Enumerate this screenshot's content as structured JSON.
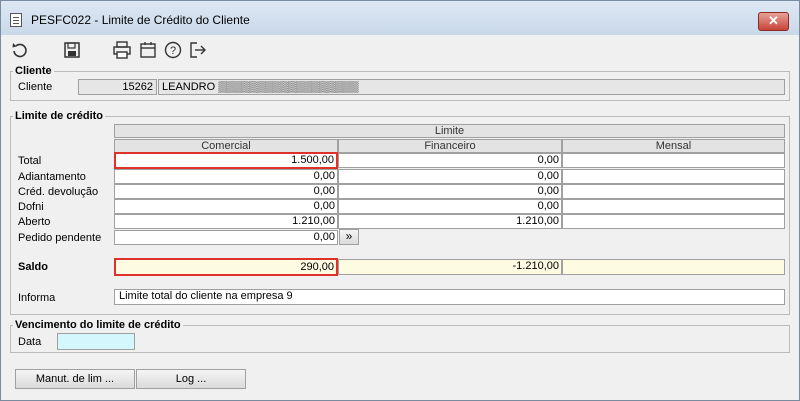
{
  "window": {
    "title": "PESFC022 - Limite de Crédito do Cliente",
    "close_label": "✕"
  },
  "toolbar": {
    "icons": [
      "refresh-icon",
      "save-icon",
      "print-icon",
      "calendar-icon",
      "help-icon",
      "exit-icon"
    ]
  },
  "cliente": {
    "legend": "Cliente",
    "label": "Cliente",
    "code": "15262",
    "name": "LEANDRO ▒▒▒▒▒▒▒▒▒▒▒▒▒▒▒▒▒▒"
  },
  "limite": {
    "legend": "Limite de  crédito",
    "group_header": "Limite",
    "columns": [
      "Comercial",
      "Financeiro",
      "Mensal"
    ],
    "rows": [
      {
        "label": "Total",
        "comercial": "1.500,00",
        "financeiro": "0,00",
        "mensal": ""
      },
      {
        "label": "Adiantamento",
        "comercial": "0,00",
        "financeiro": "0,00",
        "mensal": ""
      },
      {
        "label": "Créd. devolução",
        "comercial": "0,00",
        "financeiro": "0,00",
        "mensal": ""
      },
      {
        "label": "Dofni",
        "comercial": "0,00",
        "financeiro": "0,00",
        "mensal": ""
      },
      {
        "label": "Aberto",
        "comercial": "1.210,00",
        "financeiro": "1.210,00",
        "mensal": ""
      }
    ],
    "pedido_label": "Pedido pendente",
    "pedido_value": "0,00",
    "pedido_button": "»",
    "saldo_label": "Saldo",
    "saldo": {
      "comercial": "290,00",
      "financeiro": "-1.210,00",
      "mensal": ""
    },
    "informa_label": "Informa",
    "informa_value": "Limite total do cliente na empresa 9"
  },
  "vencimento": {
    "legend": "Vencimento do limite de crédito",
    "data_label": "Data",
    "data_value": ""
  },
  "buttons": {
    "manut": "Manut. de lim ...",
    "log": "Log ..."
  },
  "colors": {
    "highlight_red": "#e0302a",
    "saldo_bg": "#fdfbe1",
    "date_field_bg": "#d4f6fd"
  }
}
